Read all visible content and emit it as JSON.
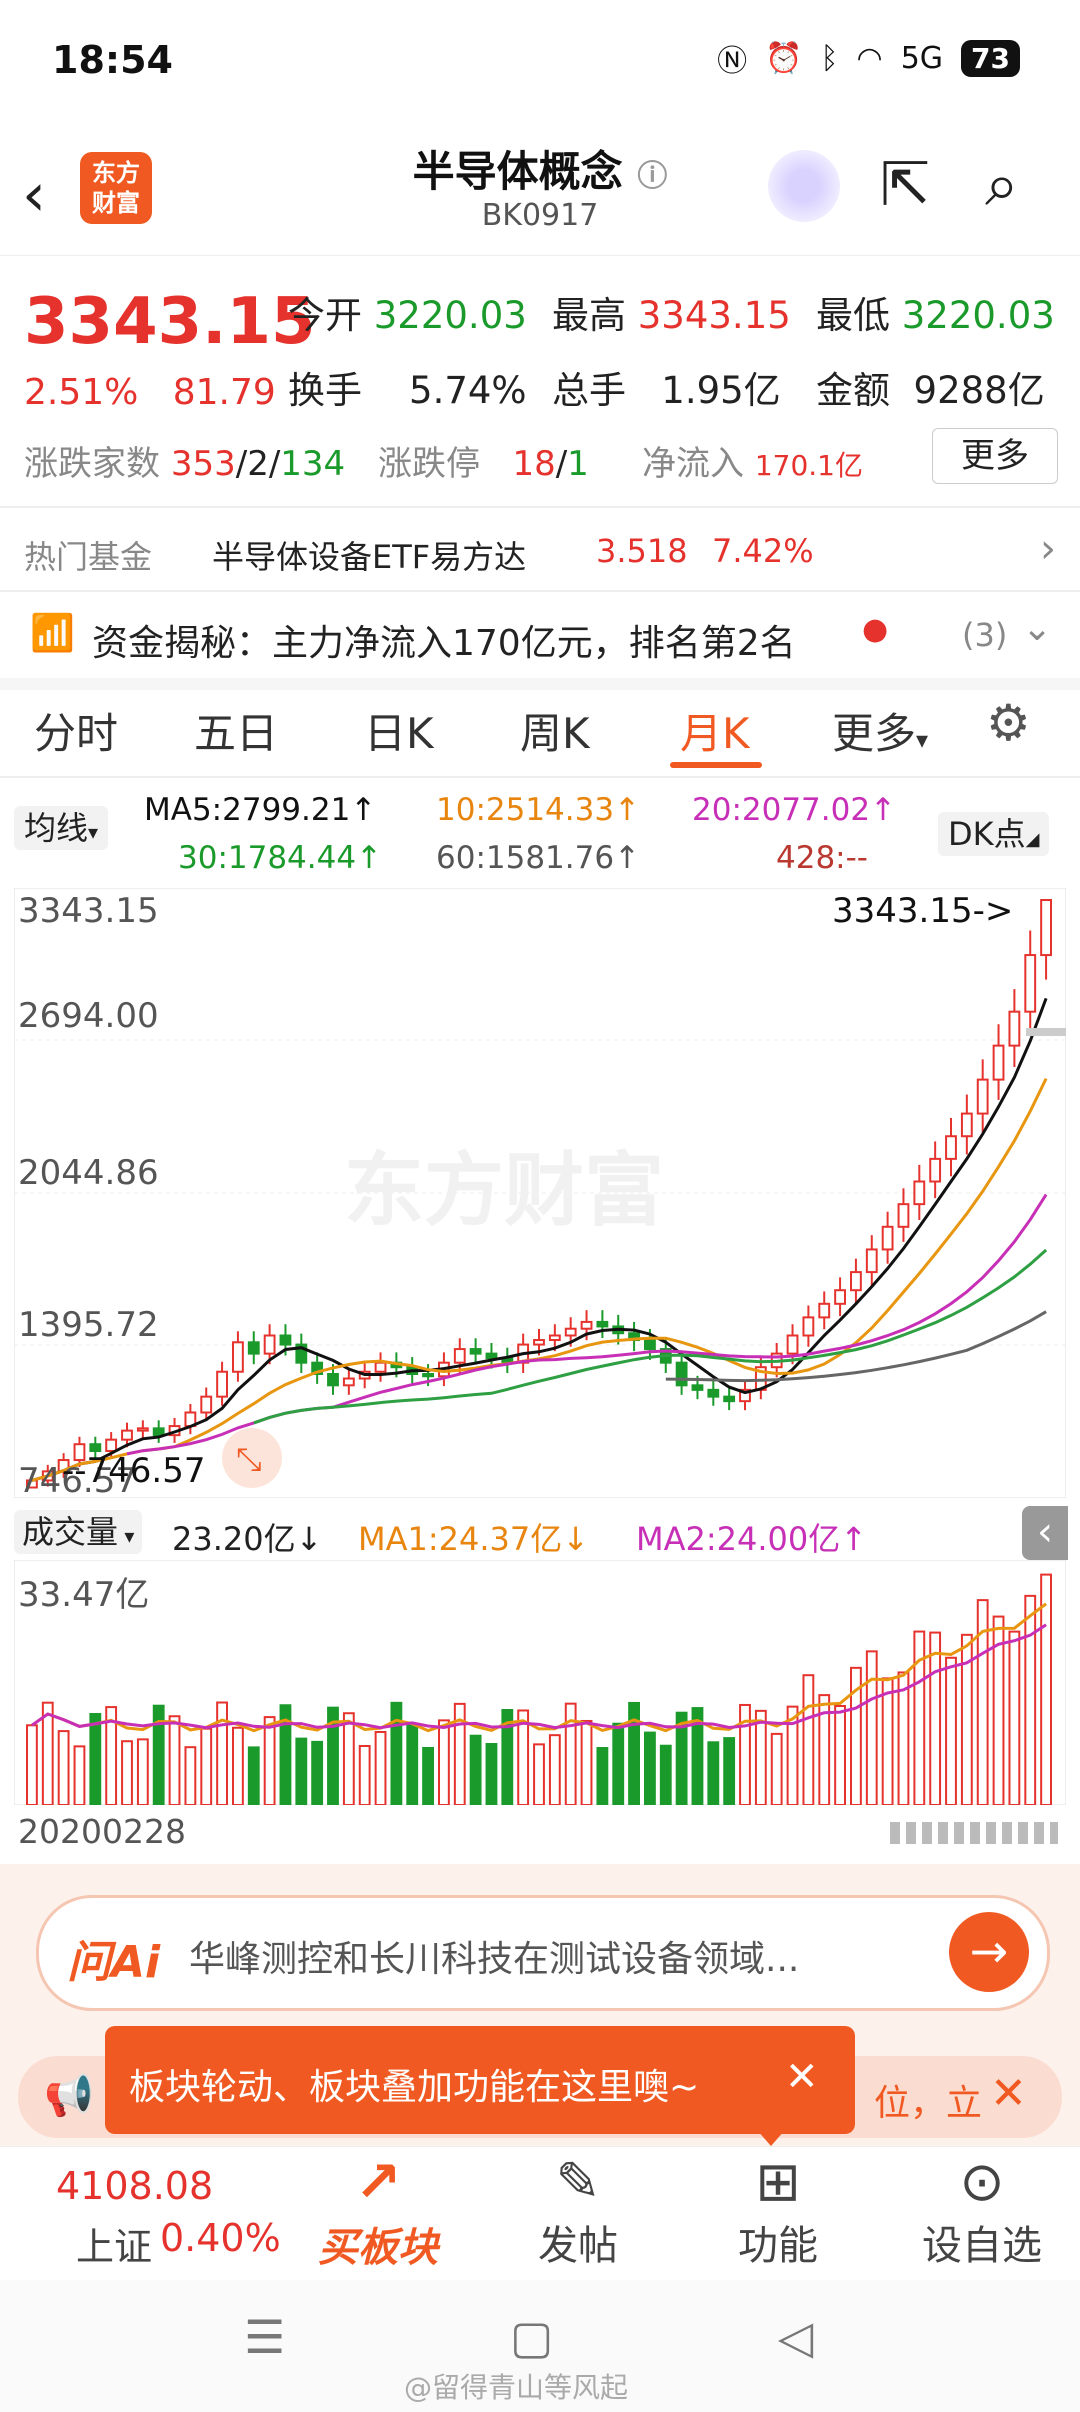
{
  "status_bar": {
    "time": "18:54",
    "battery": "73",
    "network": "5G"
  },
  "header": {
    "title": "半导体概念",
    "code": "BK0917",
    "logo_line1": "东方",
    "logo_line2": "财富"
  },
  "quote": {
    "price": "3343.15",
    "change_pct": "2.51%",
    "change": "81.79",
    "open_label": "今开",
    "open": "3220.03",
    "high_label": "最高",
    "high": "3343.15",
    "low_label": "最低",
    "low": "3220.03",
    "turnover_label": "换手",
    "turnover": "5.74%",
    "volume_label": "总手",
    "volume": "1.95亿",
    "amount_label": "金额",
    "amount": "9288亿",
    "updown_label": "涨跌家数",
    "up": "353",
    "flat": "2",
    "down": "134",
    "limit_label": "涨跌停",
    "limit_up": "18",
    "limit_down": "1",
    "netflow_label": "净流入",
    "netflow": "170.1亿",
    "more_button": "更多"
  },
  "hot_fund": {
    "label": "热门基金",
    "name": "半导体设备ETF易方达",
    "price": "3.518",
    "pct": "7.42%"
  },
  "capital": {
    "text": "资金揭秘：主力净流入170亿元，排名第2名",
    "count": "(3)"
  },
  "tabs": [
    "分时",
    "五日",
    "日K",
    "周K",
    "月K",
    "更多"
  ],
  "ma": {
    "selector": "均线",
    "ma5": "MA5:2799.21↑",
    "ma10": "10:2514.33↑",
    "ma20": "20:2077.02↑",
    "ma30": "30:1784.44↑",
    "ma60": "60:1581.76↑",
    "ma428": "428:--",
    "dk": "DK点"
  },
  "k_axis": {
    "y1": "3343.15",
    "y2": "2694.00",
    "y3": "2044.86",
    "y4": "1395.72",
    "y5": "746.57",
    "max_marker": "3343.15->",
    "min_marker": "--746.57",
    "watermark": "东方财富"
  },
  "vol": {
    "selector": "成交量",
    "value": "23.20亿↓",
    "ma1": "MA1:24.37亿↓",
    "ma2": "MA2:24.00亿↑",
    "ymax": "33.47亿",
    "start_date": "20200228"
  },
  "ai": {
    "logo": "问Ai",
    "text": "华峰测控和长川科技在测试设备领域..."
  },
  "tip": {
    "text": "板块轮动、板块叠加功能在这里噢~",
    "behind": "位，立"
  },
  "bottom_nav": {
    "index_value": "4108.08",
    "index_name": "上证",
    "index_pct": "0.40%",
    "buy": "买板块",
    "post": "发帖",
    "func": "功能",
    "watch": "设自选"
  },
  "footer_watermark": "@留得青山等风起",
  "colors": {
    "up": "#e5322d",
    "down": "#1a9a2a",
    "ma5": "#111111",
    "ma10": "#e8960f",
    "ma20": "#c72fb7",
    "ma30": "#2ea043",
    "ma60": "#666666",
    "accent": "#f05a22"
  },
  "chart_data": {
    "type": "candlestick",
    "ylim": [
      746.57,
      3343.15
    ],
    "close_approx": [
      780,
      820,
      870,
      940,
      910,
      960,
      1000,
      1010,
      980,
      1020,
      1080,
      1150,
      1260,
      1390,
      1340,
      1420,
      1380,
      1300,
      1250,
      1200,
      1230,
      1260,
      1300,
      1280,
      1250,
      1240,
      1300,
      1360,
      1340,
      1320,
      1300,
      1380,
      1400,
      1420,
      1450,
      1480,
      1460,
      1430,
      1400,
      1360,
      1300,
      1200,
      1180,
      1150,
      1130,
      1180,
      1280,
      1340,
      1420,
      1500,
      1560,
      1620,
      1700,
      1800,
      1900,
      2000,
      2100,
      2200,
      2300,
      2400,
      2550,
      2700,
      2850,
      3100,
      3343.15
    ]
  }
}
